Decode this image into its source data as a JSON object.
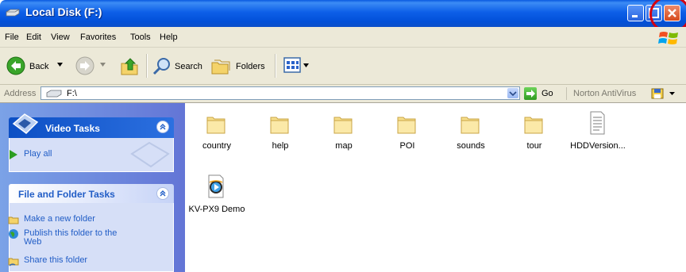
{
  "window": {
    "title": "Local Disk (F:)",
    "close_highlight_color": "#d40010"
  },
  "menubar": {
    "items": [
      "File",
      "Edit",
      "View",
      "Favorites",
      "Tools",
      "Help"
    ]
  },
  "toolbar": {
    "back_label": "Back",
    "search_label": "Search",
    "folders_label": "Folders"
  },
  "addressbar": {
    "label": "Address",
    "value": "F:\\",
    "go_label": "Go",
    "norton_label": "Norton AntiVirus"
  },
  "taskpane": {
    "video_tasks": {
      "title": "Video Tasks",
      "items": [
        "Play all"
      ]
    },
    "file_folder_tasks": {
      "title": "File and Folder Tasks",
      "items": [
        "Make a new folder",
        "Publish this folder to the Web",
        "Share this folder"
      ]
    }
  },
  "files": [
    {
      "name": "country",
      "icon": "folder-icon"
    },
    {
      "name": "help",
      "icon": "folder-icon"
    },
    {
      "name": "map",
      "icon": "folder-icon"
    },
    {
      "name": "POI",
      "icon": "folder-icon"
    },
    {
      "name": "sounds",
      "icon": "folder-icon"
    },
    {
      "name": "tour",
      "icon": "folder-icon"
    },
    {
      "name": "HDDVersion...",
      "icon": "text-file-icon"
    },
    {
      "name": "KV-PX9 Demo",
      "icon": "media-file-icon"
    }
  ]
}
